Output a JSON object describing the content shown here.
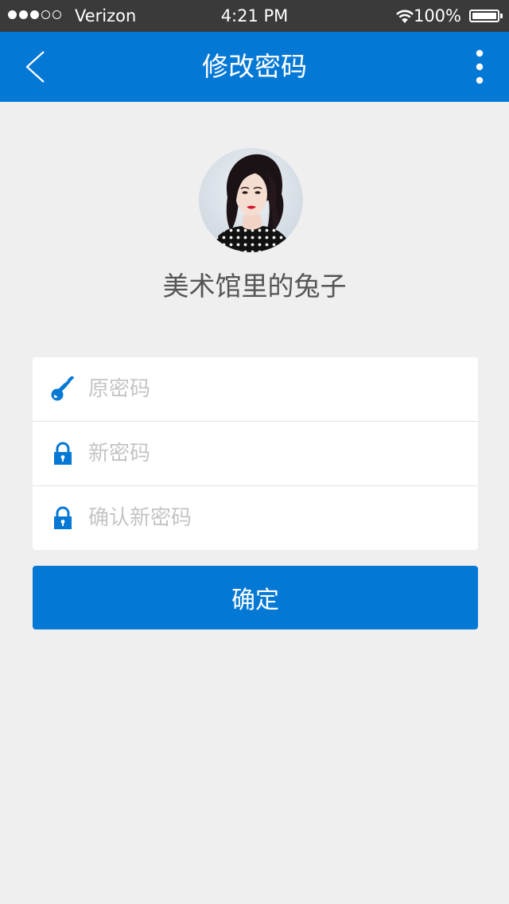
{
  "status_bar": {
    "carrier": "Verizon",
    "time": "4:21 PM",
    "battery": "100%",
    "signal_bars_filled": 3,
    "signal_bars_total": 5
  },
  "nav": {
    "title": "修改密码",
    "back_icon": "chevron-left-icon",
    "more_icon": "more-vertical-icon"
  },
  "profile": {
    "username": "美术馆里的兔子"
  },
  "form": {
    "old_password": {
      "placeholder": "原密码",
      "value": "",
      "icon": "key-icon"
    },
    "new_password": {
      "placeholder": "新密码",
      "value": "",
      "icon": "lock-icon"
    },
    "confirm_password": {
      "placeholder": "确认新密码",
      "value": "",
      "icon": "lock-icon"
    }
  },
  "confirm_button": {
    "label": "确定"
  },
  "colors": {
    "primary": "#0478d5",
    "background": "#efefef",
    "placeholder": "#c4c4c4",
    "status_bar": "#3a3a3a"
  }
}
